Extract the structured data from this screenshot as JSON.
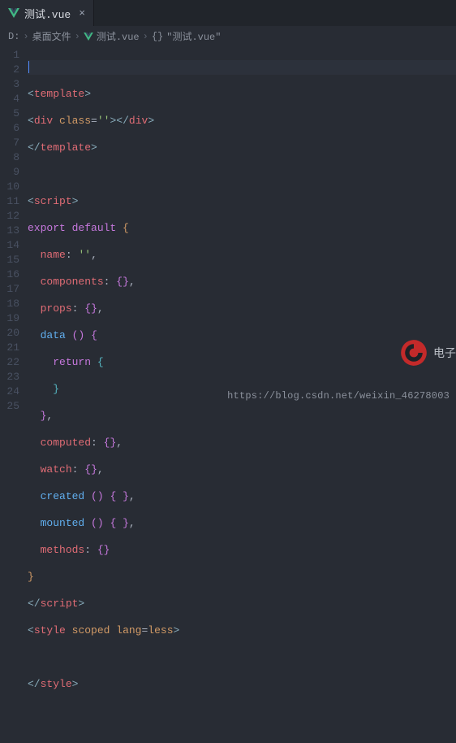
{
  "tab": {
    "filename": "测试.vue",
    "close_glyph": "×"
  },
  "breadcrumbs": {
    "sep": "›",
    "items": [
      {
        "label": "D:",
        "icon": null
      },
      {
        "label": "桌面文件",
        "icon": null
      },
      {
        "label": "测试.vue",
        "icon": "vue"
      },
      {
        "label": "\"测试.vue\"",
        "icon": "braces"
      }
    ]
  },
  "code": {
    "line_count": 25,
    "l2": {
      "o": "<",
      "t": "template",
      "c": ">"
    },
    "l3": {
      "o": "<",
      "t": "div",
      "attr": "class",
      "eq": "=",
      "q1": "'",
      "q2": "'",
      "c": ">",
      "o2": "</",
      "t2": "div",
      "c2": ">"
    },
    "l4": {
      "o": "</",
      "t": "template",
      "c": ">"
    },
    "l6": {
      "o": "<",
      "t": "script",
      "c": ">"
    },
    "l7": {
      "k1": "export",
      "k2": "default",
      "b": "{"
    },
    "l8": {
      "key": "name",
      "col": ":",
      "q1": "'",
      "q2": "'",
      "com": ","
    },
    "l9": {
      "key": "components",
      "col": ":",
      "b1": "{",
      "b2": "}",
      "com": ","
    },
    "l10": {
      "key": "props",
      "col": ":",
      "b1": "{",
      "b2": "}",
      "com": ","
    },
    "l11": {
      "fn": "data",
      "p1": "(",
      "p2": ")",
      "b": "{"
    },
    "l12": {
      "kw": "return",
      "b": "{"
    },
    "l13": {
      "b": "}"
    },
    "l14": {
      "b": "}",
      "com": ","
    },
    "l15": {
      "key": "computed",
      "col": ":",
      "b1": "{",
      "b2": "}",
      "com": ","
    },
    "l16": {
      "key": "watch",
      "col": ":",
      "b1": "{",
      "b2": "}",
      "com": ","
    },
    "l17": {
      "fn": "created",
      "p1": "(",
      "p2": ")",
      "b1": "{",
      "b2": "}",
      "com": ","
    },
    "l18": {
      "fn": "mounted",
      "p1": "(",
      "p2": ")",
      "b1": "{",
      "b2": "}",
      "com": ","
    },
    "l19": {
      "key": "methods",
      "col": ":",
      "b1": "{",
      "b2": "}"
    },
    "l20": {
      "b": "}"
    },
    "l21": {
      "o": "</",
      "t": "script",
      "c": ">"
    },
    "l22": {
      "o": "<",
      "t": "style",
      "a1": "scoped",
      "a2": "lang",
      "eq": "=",
      "v": "less",
      "c": ">"
    },
    "l24": {
      "o": "</",
      "t": "style",
      "c": ">"
    }
  },
  "watermark_text": "电子",
  "footer_url": "https://blog.csdn.net/weixin_46278003"
}
